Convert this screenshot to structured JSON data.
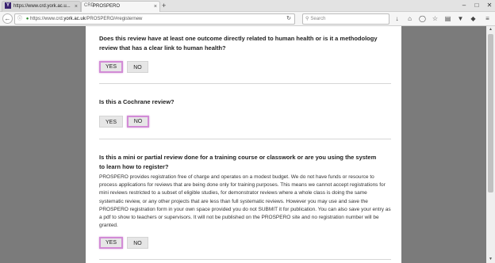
{
  "browser": {
    "tabs": [
      {
        "label": "https://www.crd.york.ac.u...",
        "favicon": "Y"
      },
      {
        "label": "PROSPERO",
        "favicon": "CRD"
      }
    ],
    "url": {
      "prefix": "https://www.crd.",
      "host": "york.ac.uk",
      "path": "/PROSPERO/#registernew"
    },
    "search_placeholder": "Search",
    "new_tab": "+",
    "close_tab": "×",
    "window_controls": [
      "–",
      "□",
      "✕"
    ]
  },
  "questions": [
    {
      "text": "Does this review have at least one outcome directly related to human health or is it a methodology review that has a clear link to human health?",
      "yes_label": "YES",
      "no_label": "NO",
      "selected": "yes"
    },
    {
      "text": "Is this a Cochrane review?",
      "yes_label": "YES",
      "no_label": "NO",
      "selected": "no"
    },
    {
      "text": "Is this a mini or partial review done for a training course or classwork or are you using the system to learn how to register?",
      "paragraph": "PROSPERO provides registration free of charge and operates on a modest budget. We do not have funds or resource to process applications for reviews that are being done only for training purposes. This means we cannot accept registrations for mini reviews restricted to a subset of eligible studies, for demonstrator reviews where a whole class is doing the same systematic review, or any other projects that are less than full systematic reviews. However you may use and save the PROSPERO registration form in your own space provided you do not SUBMIT it for publication. You can also save your entry as a pdf to show to teachers or supervisors. It will not be published on the PROSPERO site and no registration number will be granted.",
      "yes_label": "YES",
      "no_label": "NO",
      "selected": "yes"
    }
  ]
}
